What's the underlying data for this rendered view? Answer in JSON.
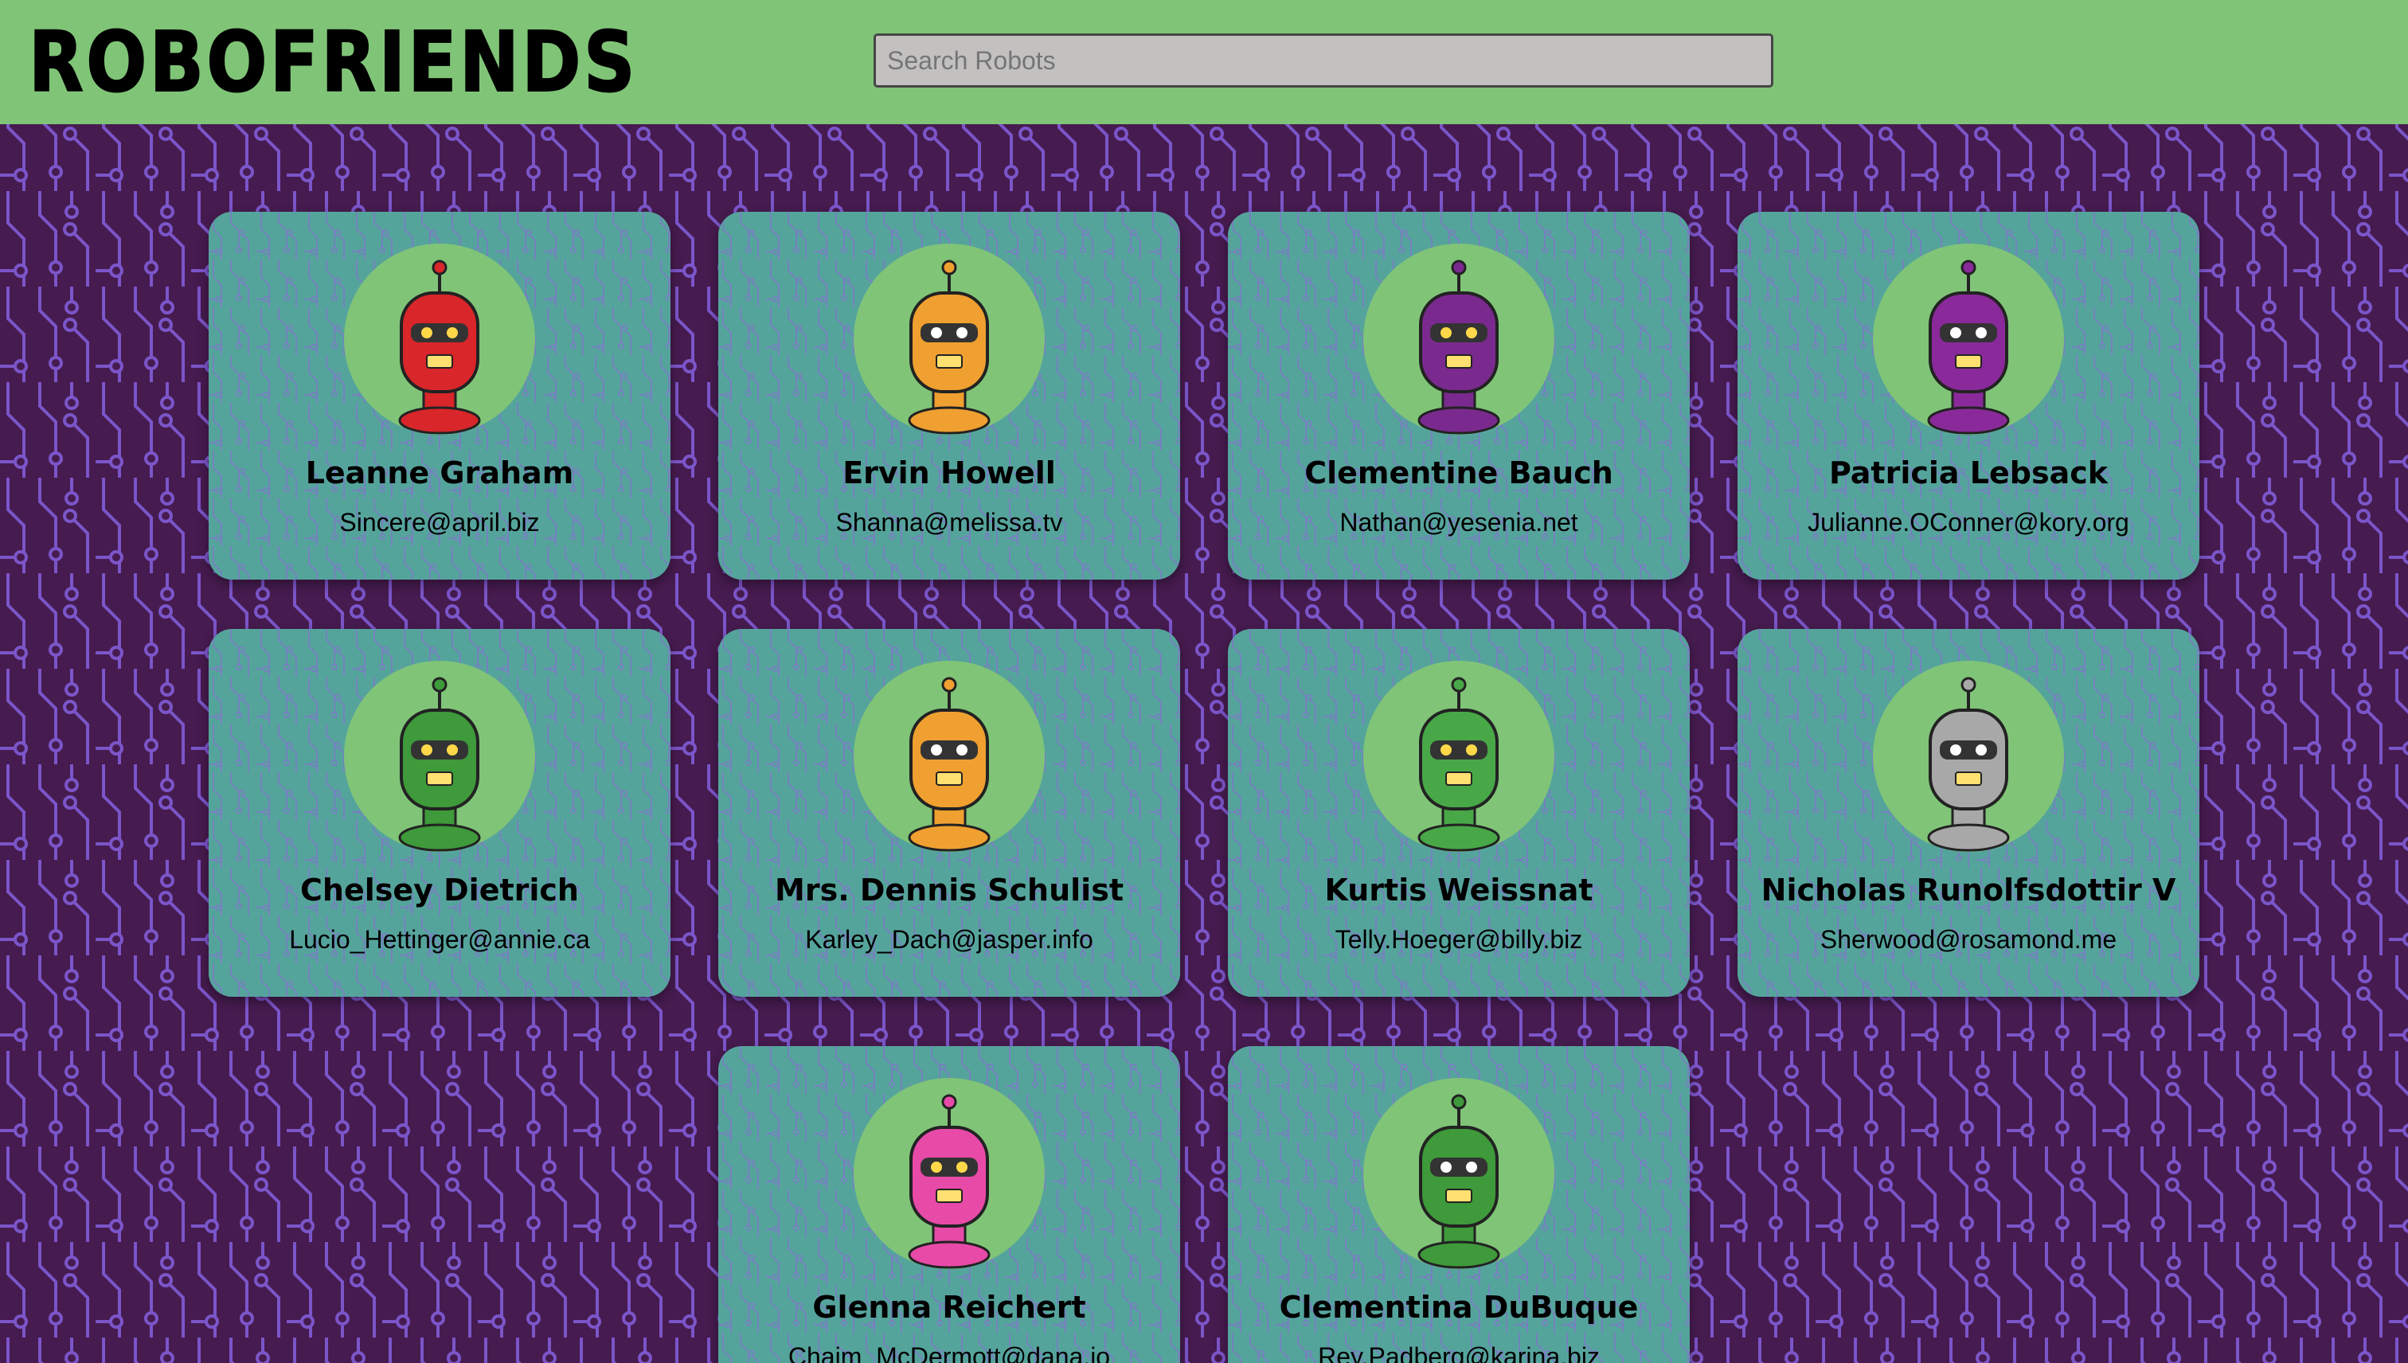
{
  "app": {
    "title": "ROBOFRIENDS"
  },
  "search": {
    "placeholder": "Search Robots",
    "value": ""
  },
  "colors": {
    "header_bg": "#80c478",
    "page_bg": "#461b4f",
    "circuit_line": "#7a52c8",
    "card_bg": "#55a49c",
    "avatar_bg": "#80c478"
  },
  "robots": [
    {
      "name": "Leanne Graham",
      "email": "Sincere@april.biz",
      "icon": "red-robot-icon",
      "color": "#d8262a"
    },
    {
      "name": "Ervin Howell",
      "email": "Shanna@melissa.tv",
      "icon": "orange-robot-icon",
      "color": "#f0a030"
    },
    {
      "name": "Clementine Bauch",
      "email": "Nathan@yesenia.net",
      "icon": "purple-robot-icon",
      "color": "#7a2a8e"
    },
    {
      "name": "Patricia Lebsack",
      "email": "Julianne.OConner@kory.org",
      "icon": "purple-box-robot-icon",
      "color": "#8a2a9a"
    },
    {
      "name": "Chelsey Dietrich",
      "email": "Lucio_Hettinger@annie.ca",
      "icon": "green-robot-icon",
      "color": "#3e9a3a"
    },
    {
      "name": "Mrs. Dennis Schulist",
      "email": "Karley_Dach@jasper.info",
      "icon": "orange-round-robot-icon",
      "color": "#f0a030"
    },
    {
      "name": "Kurtis Weissnat",
      "email": "Telly.Hoeger@billy.biz",
      "icon": "green-alien-robot-icon",
      "color": "#48a848"
    },
    {
      "name": "Nicholas Runolfsdottir V",
      "email": "Sherwood@rosamond.me",
      "icon": "gray-robot-icon",
      "color": "#a8a8a8"
    },
    {
      "name": "Glenna Reichert",
      "email": "Chaim_McDermott@dana.io",
      "icon": "pink-robot-icon",
      "color": "#e84aa8"
    },
    {
      "name": "Clementina DuBuque",
      "email": "Rey.Padberg@karina.biz",
      "icon": "green-hat-robot-icon",
      "color": "#3e9a3a"
    }
  ]
}
